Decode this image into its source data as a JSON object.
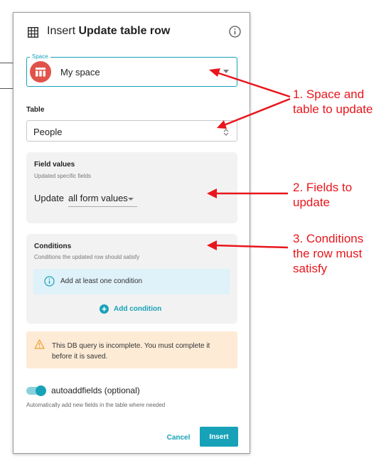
{
  "dialog": {
    "title_prefix": "Insert",
    "title_bold": "Update table row",
    "space": {
      "legend": "Space",
      "value": "My space"
    },
    "table": {
      "label": "Table",
      "value": "People"
    },
    "field_values": {
      "title": "Field values",
      "subtitle": "Updated specific fields",
      "update_label": "Update",
      "update_value": "all form values"
    },
    "conditions": {
      "title": "Conditions",
      "subtitle": "Conditions the updated row should satisfy",
      "notice": "Add at least one condition",
      "add_label": "Add condition"
    },
    "warning": {
      "text": "This DB query is incomplete. You must complete it before it is saved."
    },
    "autoadd": {
      "label": "autoaddfields (optional)",
      "help": "Automatically add new fields in the table where needed",
      "enabled": true
    },
    "buttons": {
      "cancel": "Cancel",
      "insert": "Insert"
    }
  },
  "annotations": {
    "one_line1": "1. Space and",
    "one_line2": "table to update",
    "two_line1": "2. Fields to",
    "two_line2": "update",
    "three_line1": "3. Conditions",
    "three_line2": "the row must",
    "three_line3": "satisfy"
  },
  "colors": {
    "accent": "#17a2b8",
    "annotation": "#e8161c",
    "warning_bg": "#fdebd6",
    "notice_bg": "#dff1f9",
    "space_avatar": "#e0534a"
  },
  "icons": {
    "title": "table-icon",
    "info": "info-icon",
    "space": "table-layout-icon",
    "warning": "warning-triangle-icon",
    "add": "plus-circle-icon"
  }
}
